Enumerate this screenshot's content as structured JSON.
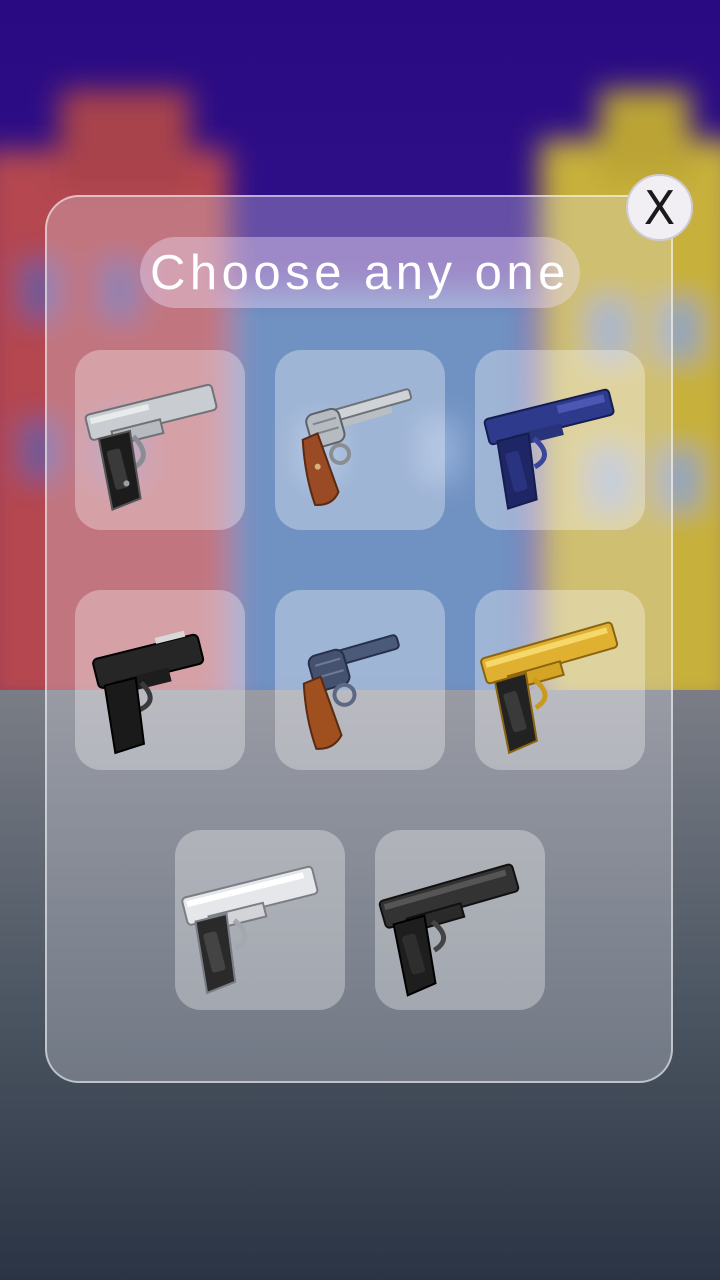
{
  "dialog": {
    "title": "Choose any one",
    "close_label": "X"
  },
  "weapons": [
    {
      "name": "silver-pistol",
      "icon": "silver-pistol-icon",
      "colors": {
        "body": "#c9ccd0",
        "grip": "#1c1c1c"
      }
    },
    {
      "name": "silver-revolver",
      "icon": "revolver-icon",
      "colors": {
        "body": "#c8cdd4",
        "grip": "#9a4a24"
      }
    },
    {
      "name": "blue-pistol",
      "icon": "blue-pistol-icon",
      "colors": {
        "body": "#2e3a8c",
        "grip": "#1f2666"
      }
    },
    {
      "name": "black-compact-pistol",
      "icon": "compact-pistol-icon",
      "colors": {
        "body": "#262626",
        "grip": "#1a1a1a"
      }
    },
    {
      "name": "blue-revolver",
      "icon": "snub-revolver-icon",
      "colors": {
        "body": "#4b5a78",
        "grip": "#a0501f"
      }
    },
    {
      "name": "gold-pistol",
      "icon": "gold-pistol-icon",
      "colors": {
        "body": "#e0b030",
        "grip": "#222222"
      }
    },
    {
      "name": "chrome-pistol",
      "icon": "chrome-pistol-icon",
      "colors": {
        "body": "#e6e7ea",
        "grip": "#2a2a2a"
      }
    },
    {
      "name": "black-pistol",
      "icon": "black-pistol-icon",
      "colors": {
        "body": "#333333",
        "grip": "#1e1e1e"
      }
    }
  ]
}
